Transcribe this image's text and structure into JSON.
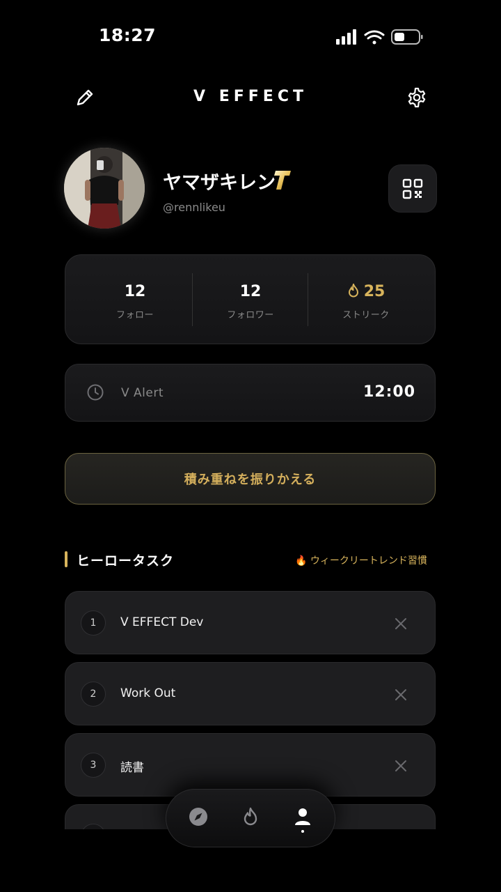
{
  "status_bar": {
    "time": "18:27"
  },
  "header": {
    "title": "V EFFECT"
  },
  "profile": {
    "name": "ヤマザキレン",
    "badge": "T",
    "handle": "@rennlikeu"
  },
  "stats": [
    {
      "value": "12",
      "label": "フォロー"
    },
    {
      "value": "12",
      "label": "フォロワー"
    },
    {
      "value": "25",
      "label": "ストリーク"
    }
  ],
  "alert": {
    "label": "V Alert",
    "time": "12:00"
  },
  "reflect_button": {
    "label": "積み重ねを振りかえる"
  },
  "section": {
    "title": "ヒーロータスク",
    "link": "🔥 ウィークリートレンド習慣"
  },
  "tasks": [
    {
      "num": "1",
      "text": "V EFFECT Dev"
    },
    {
      "num": "2",
      "text": "Work Out"
    },
    {
      "num": "3",
      "text": "読書"
    }
  ],
  "colors": {
    "accent": "#d8b45c",
    "background": "#000000",
    "card": "#1e1e20"
  },
  "tabbar": {
    "tabs": [
      "compass-icon",
      "flame-icon",
      "profile-icon"
    ],
    "active": "profile-icon"
  }
}
